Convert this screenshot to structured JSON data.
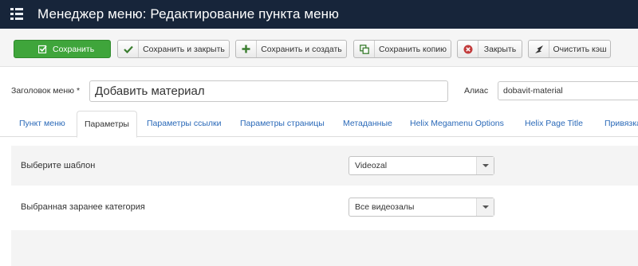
{
  "header": {
    "title": "Менеджер меню: Редактирование пункта меню",
    "menu_icon": "list-icon"
  },
  "toolbar": {
    "save": "Сохранить",
    "save_close": "Сохранить и закрыть",
    "save_new": "Сохранить и создать",
    "save_copy": "Сохранить копию",
    "close": "Закрыть",
    "clear_cache": "Очистить кэш"
  },
  "form": {
    "title_label": "Заголовок меню",
    "required_mark": "*",
    "title_value": "Добавить материал",
    "alias_label": "Алиас",
    "alias_value": "dobavit-material"
  },
  "tabs": [
    {
      "label": "Пункт меню"
    },
    {
      "label": "Параметры",
      "active": true
    },
    {
      "label": "Параметры ссылки"
    },
    {
      "label": "Параметры страницы"
    },
    {
      "label": "Метаданные"
    },
    {
      "label": "Helix Megamenu Options"
    },
    {
      "label": "Helix Page Title"
    },
    {
      "label": "Привязка"
    }
  ],
  "params": [
    {
      "label": "Выберите шаблон",
      "value": "Videozal"
    },
    {
      "label": "Выбранная заранее категория",
      "value": "Все видеозалы"
    }
  ],
  "colors": {
    "header_bg": "#17253a",
    "success": "#3fa53b",
    "link": "#2a69b8",
    "danger": "#c23b3b"
  }
}
